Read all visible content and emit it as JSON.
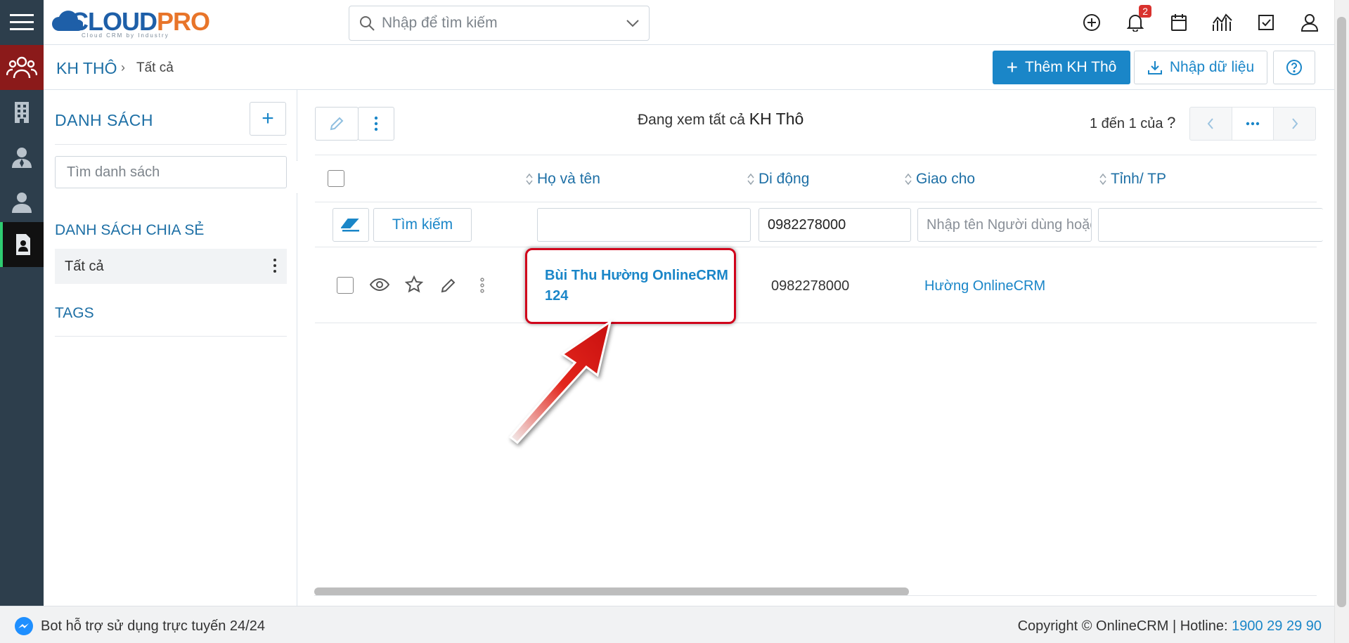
{
  "app": {
    "logo": {
      "brand_a": "CLOUD",
      "brand_b": "PRO",
      "tagline": "Cloud CRM by Industry"
    },
    "search": {
      "placeholder": "Nhập để tìm kiếm"
    },
    "notifications_count": "2",
    "top_icons": [
      "add-circle-icon",
      "bell-icon",
      "calendar-icon",
      "chart-icon",
      "checkbox-icon",
      "user-icon"
    ],
    "rail_icons": [
      "menu-icon",
      "customers-icon",
      "building-icon",
      "contact-icon",
      "person-icon",
      "lead-card-icon"
    ]
  },
  "breadcrumb": {
    "module": "KH THÔ",
    "current": "Tất cả"
  },
  "header_actions": {
    "add_label": "Thêm KH Thô",
    "import_label": "Nhập dữ liệu"
  },
  "sidebar": {
    "title": "DANH SÁCH",
    "search_placeholder": "Tìm danh sách",
    "shared_title": "DANH SÁCH CHIA SẺ",
    "items": [
      {
        "label": "Tất cả"
      }
    ],
    "tags_title": "TAGS"
  },
  "listview": {
    "viewing_prefix": "Đang xem tất cả",
    "viewing_module": "KH Thô",
    "pager_text": "1 đến 1 của",
    "pager_unknown": "?",
    "columns": [
      "Họ và tên",
      "Di động",
      "Giao cho",
      "Tỉnh/ TP"
    ],
    "filter": {
      "search_button": "Tìm kiếm",
      "name_value": "",
      "mobile_value": "0982278000",
      "assignee_placeholder": "Nhập tên Người dùng hoặc nhóm",
      "province_value": ""
    },
    "rows": [
      {
        "name_line1": "Bùi Thu Hường OnlineCRM",
        "name_line2": "124",
        "mobile": "0982278000",
        "assignee": "Hường OnlineCRM",
        "province": ""
      }
    ]
  },
  "footer": {
    "bot_text": "Bot hỗ trợ sử dụng trực tuyến 24/24",
    "copyright": "Copyright © OnlineCRM | Hotline: ",
    "hotline": "1900 29 29 90"
  },
  "colors": {
    "accent": "#1a86c8",
    "rail": "#2d3e4c",
    "highlight": "#d0021b"
  }
}
